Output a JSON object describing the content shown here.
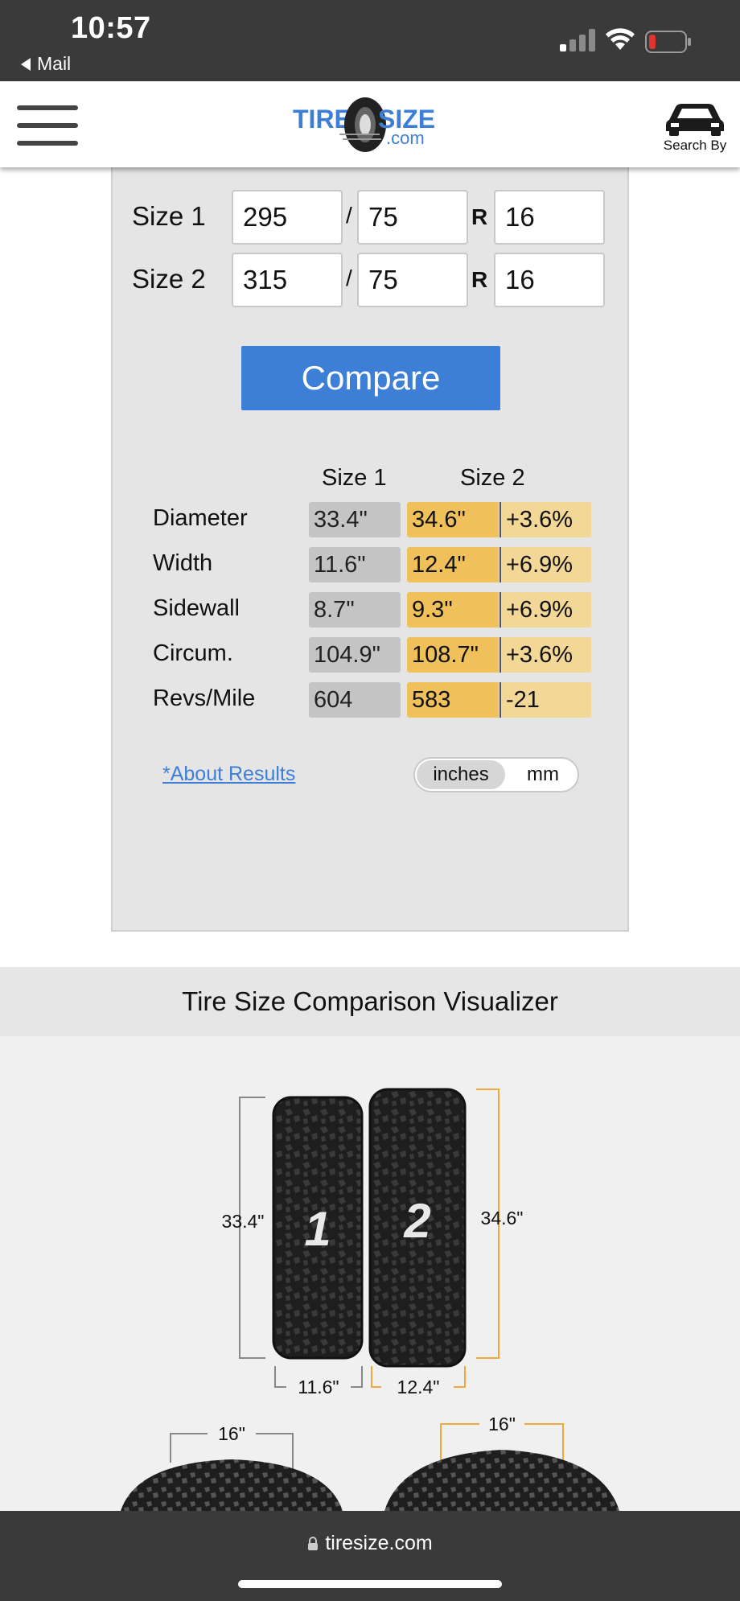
{
  "status_bar": {
    "time": "10:57",
    "back_app": "Mail",
    "signal_icon": "signal-icon",
    "wifi_icon": "wifi-icon",
    "battery_icon": "battery-low-icon",
    "battery_level": 0.15
  },
  "header": {
    "menu_icon": "hamburger-menu-icon",
    "logo_text_main": "TIRE SIZE",
    "logo_text_sub": ".com",
    "search_by_label": "Search By",
    "search_by_icon": "car-icon"
  },
  "calculator": {
    "rows": [
      {
        "label": "Size 1",
        "width": "295",
        "aspect": "75",
        "rim": "16"
      },
      {
        "label": "Size 2",
        "width": "315",
        "aspect": "75",
        "rim": "16"
      }
    ],
    "separator": "/",
    "construction": "R",
    "compare_label": "Compare",
    "colors": {
      "accent": "#3d7fd6",
      "size2": "#f0c05b",
      "diff": "#f3d797",
      "size1": "#c4c4c4"
    }
  },
  "results": {
    "col1_header": "Size 1",
    "col2_header": "Size 2",
    "rows": [
      {
        "label": "Diameter",
        "size1": "33.4\"",
        "size2": "34.6\"",
        "diff": "+3.6%"
      },
      {
        "label": "Width",
        "size1": "11.6\"",
        "size2": "12.4\"",
        "diff": "+6.9%"
      },
      {
        "label": "Sidewall",
        "size1": "8.7\"",
        "size2": "9.3\"",
        "diff": "+6.9%"
      },
      {
        "label": "Circum.",
        "size1": "104.9\"",
        "size2": "108.7\"",
        "diff": "+3.6%"
      },
      {
        "label": "Revs/Mile",
        "size1": "604",
        "size2": "583",
        "diff": "-21"
      }
    ],
    "about_link": "*About Results",
    "units": {
      "inches": "inches",
      "mm": "mm",
      "selected": "inches"
    }
  },
  "visualizer": {
    "title": "Tire Size Comparison Visualizer",
    "tire1_number": "1",
    "tire2_number": "2",
    "tire1_diameter": "33.4\"",
    "tire2_diameter": "34.6\"",
    "tire1_width": "11.6\"",
    "tire2_width": "12.4\"",
    "rim1": "16\"",
    "rim2": "16\""
  },
  "browser": {
    "url": "tiresize.com",
    "lock_icon": "lock-icon"
  }
}
